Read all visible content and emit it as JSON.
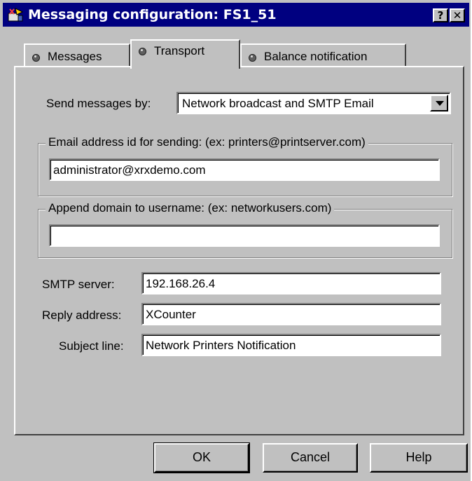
{
  "window": {
    "title": "Messaging configuration: FS1_51",
    "help_button": "?",
    "close_button": "✕"
  },
  "tabs": [
    {
      "label": "Messages",
      "active": false
    },
    {
      "label": "Transport",
      "active": true
    },
    {
      "label": "Balance notification",
      "active": false
    }
  ],
  "transport": {
    "send_by_label": "Send messages by:",
    "send_by_value": "Network broadcast and SMTP Email",
    "email_group_label": "Email address id for sending: (ex: printers@printserver.com)",
    "email_value": "administrator@xrxdemo.com",
    "domain_group_label": "Append domain to username: (ex: networkusers.com)",
    "domain_value": "",
    "smtp_label": "SMTP server:",
    "smtp_value": "192.168.26.4",
    "reply_label": "Reply address:",
    "reply_value": "XCounter",
    "subject_label": "Subject line:",
    "subject_value": "Network Printers Notification"
  },
  "buttons": {
    "ok": "OK",
    "cancel": "Cancel",
    "help": "Help"
  },
  "colors": {
    "titlebar": "#000080",
    "face": "#c0c0c0"
  }
}
